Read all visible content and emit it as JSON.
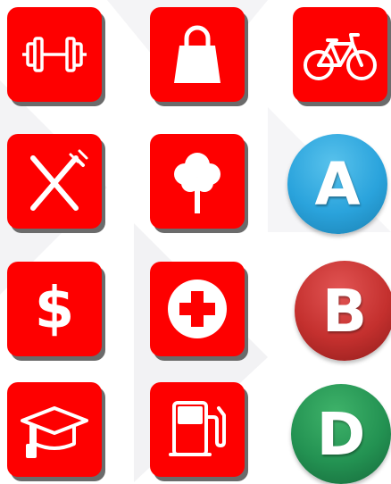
{
  "icons": [
    {
      "name": "dumbbell-icon"
    },
    {
      "name": "shopping-bag-icon"
    },
    {
      "name": "bicycle-icon"
    },
    {
      "name": "fork-knife-icon"
    },
    {
      "name": "tree-icon"
    },
    {
      "name": "dollar-icon"
    },
    {
      "name": "medical-cross-icon"
    },
    {
      "name": "graduation-cap-icon"
    },
    {
      "name": "fuel-pump-icon"
    }
  ],
  "badges": {
    "a": {
      "letter": "A",
      "color": "#2aa3dc"
    },
    "b": {
      "letter": "B",
      "color": "#c4302e"
    },
    "d": {
      "letter": "D",
      "color": "#239252"
    }
  },
  "tile_color": "#fe0000",
  "dollar_symbol": "$"
}
